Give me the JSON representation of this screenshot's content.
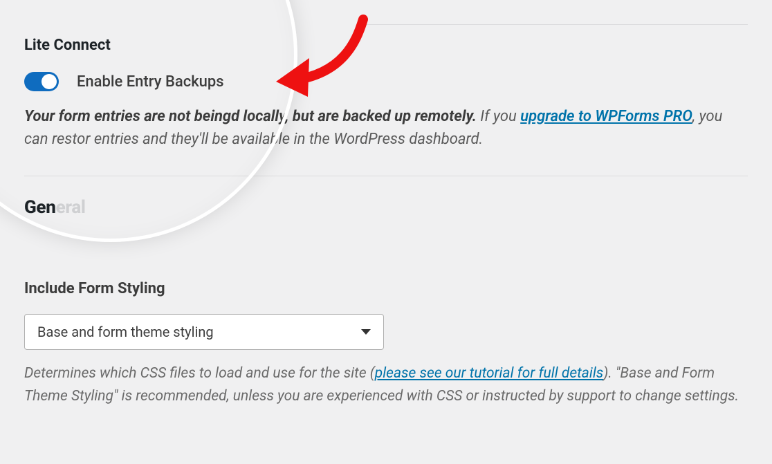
{
  "lite_connect": {
    "title": "Lite Connect",
    "toggle_label": "Enable Entry Backups",
    "toggle_on": true,
    "desc_bold1": "Your form entries are not being",
    "desc_bold2": "d locally, but are backed up remotely.",
    "desc_plain1": " If you ",
    "upgrade_link": "upgrade to WPForms PRO",
    "desc_plain2": ", you can resto",
    "desc_plain3": "r entries and they'll be available in the WordPress dashboard."
  },
  "general": {
    "title": "General"
  },
  "form_styling": {
    "label": "Include Form Styling",
    "selected": "Base and form theme styling",
    "help_pre": "Determines which CSS files to load and use for the site (",
    "help_link": "please see our tutorial for full details",
    "help_post": "). \"Base and Form Theme Styling\" is recommended, unless you are experienced with CSS or instructed by support to change settings."
  }
}
